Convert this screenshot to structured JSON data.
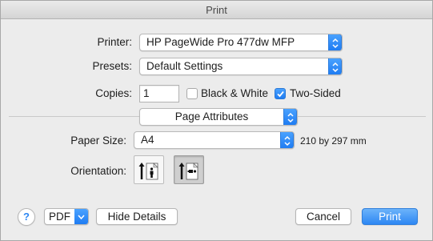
{
  "window": {
    "title": "Print"
  },
  "printer": {
    "label": "Printer:",
    "value": "HP PageWide Pro 477dw MFP"
  },
  "presets": {
    "label": "Presets:",
    "value": "Default Settings"
  },
  "copies": {
    "label": "Copies:",
    "value": "1",
    "black_white": {
      "label": "Black & White",
      "checked": false
    },
    "two_sided": {
      "label": "Two-Sided",
      "checked": true
    }
  },
  "section": {
    "value": "Page Attributes"
  },
  "paper_size": {
    "label": "Paper Size:",
    "value": "A4",
    "dimensions": "210 by 297 mm"
  },
  "orientation": {
    "label": "Orientation:",
    "selected": "landscape",
    "options": [
      "portrait",
      "landscape"
    ]
  },
  "footer": {
    "help": "?",
    "pdf": "PDF",
    "hide_details": "Hide Details",
    "cancel": "Cancel",
    "print": "Print"
  },
  "colors": {
    "accent": "#2d87f3",
    "window_bg": "#ececec"
  }
}
